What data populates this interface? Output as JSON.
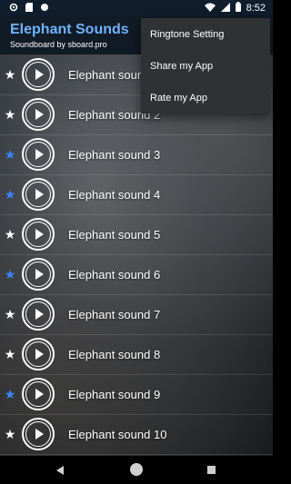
{
  "status_bar": {
    "time": "8:52",
    "left_icons": [
      "settings-icon",
      "sd-card-icon",
      "circle-icon"
    ],
    "right_icons": [
      "wifi-icon",
      "signal-icon",
      "battery-icon"
    ]
  },
  "app_bar": {
    "title": "Elephant Sounds",
    "subtitle": "Soundboard by sboard.pro",
    "title_color": "#6fb3ff"
  },
  "overflow_menu": {
    "items": [
      "Ringtone Setting",
      "Share my App",
      "Rate my App"
    ]
  },
  "sounds": [
    {
      "label": "Elephant sound 1",
      "favorite": false
    },
    {
      "label": "Elephant sound 2",
      "favorite": false
    },
    {
      "label": "Elephant sound 3",
      "favorite": true
    },
    {
      "label": "Elephant sound 4",
      "favorite": true
    },
    {
      "label": "Elephant sound 5",
      "favorite": false
    },
    {
      "label": "Elephant sound 6",
      "favorite": true
    },
    {
      "label": "Elephant sound 7",
      "favorite": false
    },
    {
      "label": "Elephant sound 8",
      "favorite": false
    },
    {
      "label": "Elephant sound 9",
      "favorite": true
    },
    {
      "label": "Elephant sound 10",
      "favorite": false
    }
  ],
  "star_glyph": "★",
  "colors": {
    "favorite_star": "#3b86ff",
    "normal_star": "#ffffff"
  },
  "nav_bar": {
    "icons": [
      "back-icon",
      "home-icon",
      "recents-icon"
    ]
  }
}
